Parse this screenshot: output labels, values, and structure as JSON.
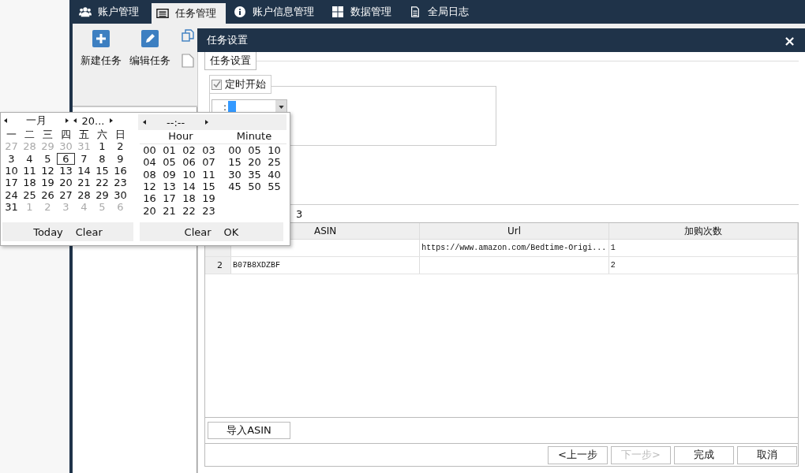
{
  "app_tabs": [
    {
      "label": "账户管理",
      "kind": "users",
      "selected": false
    },
    {
      "label": "任务管理",
      "kind": "list",
      "selected": true
    },
    {
      "label": "账户信息管理",
      "kind": "info",
      "selected": false
    },
    {
      "label": "数据管理",
      "kind": "grid",
      "selected": false
    },
    {
      "label": "全局日志",
      "kind": "doc",
      "selected": false
    }
  ],
  "toolbar": [
    {
      "label": "新建任务",
      "kind": "plus"
    },
    {
      "label": "编辑任务",
      "kind": "edit"
    }
  ],
  "dialog": {
    "title": "任务设置",
    "close": "×",
    "group_title": "任务设置",
    "schedule": {
      "label": "定时开始",
      "checked": true,
      "time_value": ":"
    },
    "count_text": "3",
    "table": {
      "columns": [
        "ASIN",
        "Url",
        "加购次数"
      ],
      "rows": [
        {
          "url": "https://www.amazon.com/Bedtime-Origi...",
          "count": "1"
        },
        {
          "number": "2",
          "asin": "B07B8XDZBF",
          "url": "",
          "count": "2"
        }
      ]
    },
    "import_button": "导入ASIN",
    "nav_buttons": [
      {
        "label": "<上一步",
        "disabled": false
      },
      {
        "label": "下一步>",
        "disabled": true
      },
      {
        "label": "完成",
        "disabled": false
      },
      {
        "label": "取消",
        "disabled": false
      }
    ]
  },
  "date_picker": {
    "month": "一月",
    "year": "20...",
    "weekdays": [
      "一",
      "二",
      "三",
      "四",
      "五",
      "六",
      "日"
    ],
    "days": [
      {
        "day": "27",
        "outside": true,
        "selected": false
      },
      {
        "day": "28",
        "outside": true,
        "selected": false
      },
      {
        "day": "29",
        "outside": true,
        "selected": false
      },
      {
        "day": "30",
        "outside": true,
        "selected": false
      },
      {
        "day": "31",
        "outside": true,
        "selected": false
      },
      {
        "day": "1",
        "outside": false,
        "selected": false
      },
      {
        "day": "2",
        "outside": false,
        "selected": false
      },
      {
        "day": "3",
        "outside": false,
        "selected": false
      },
      {
        "day": "4",
        "outside": false,
        "selected": false
      },
      {
        "day": "5",
        "outside": false,
        "selected": false
      },
      {
        "day": "6",
        "outside": false,
        "selected": true
      },
      {
        "day": "7",
        "outside": false,
        "selected": false
      },
      {
        "day": "8",
        "outside": false,
        "selected": false
      },
      {
        "day": "9",
        "outside": false,
        "selected": false
      },
      {
        "day": "10",
        "outside": false,
        "selected": false
      },
      {
        "day": "11",
        "outside": false,
        "selected": false
      },
      {
        "day": "12",
        "outside": false,
        "selected": false
      },
      {
        "day": "13",
        "outside": false,
        "selected": false
      },
      {
        "day": "14",
        "outside": false,
        "selected": false
      },
      {
        "day": "15",
        "outside": false,
        "selected": false
      },
      {
        "day": "16",
        "outside": false,
        "selected": false
      },
      {
        "day": "17",
        "outside": false,
        "selected": false
      },
      {
        "day": "18",
        "outside": false,
        "selected": false
      },
      {
        "day": "19",
        "outside": false,
        "selected": false
      },
      {
        "day": "20",
        "outside": false,
        "selected": false
      },
      {
        "day": "21",
        "outside": false,
        "selected": false
      },
      {
        "day": "22",
        "outside": false,
        "selected": false
      },
      {
        "day": "23",
        "outside": false,
        "selected": false
      },
      {
        "day": "24",
        "outside": false,
        "selected": false
      },
      {
        "day": "25",
        "outside": false,
        "selected": false
      },
      {
        "day": "26",
        "outside": false,
        "selected": false
      },
      {
        "day": "27",
        "outside": false,
        "selected": false
      },
      {
        "day": "28",
        "outside": false,
        "selected": false
      },
      {
        "day": "29",
        "outside": false,
        "selected": false
      },
      {
        "day": "30",
        "outside": false,
        "selected": false
      },
      {
        "day": "31",
        "outside": false,
        "selected": false
      },
      {
        "day": "1",
        "outside": true,
        "selected": false
      },
      {
        "day": "2",
        "outside": true,
        "selected": false
      },
      {
        "day": "3",
        "outside": true,
        "selected": false
      },
      {
        "day": "4",
        "outside": true,
        "selected": false
      },
      {
        "day": "5",
        "outside": true,
        "selected": false
      },
      {
        "day": "6",
        "outside": true,
        "selected": false
      }
    ],
    "footer": [
      "Today",
      "Clear"
    ]
  },
  "time_picker": {
    "display": "--:--",
    "hour_label": "Hour",
    "minute_label": "Minute",
    "hours": [
      "00",
      "01",
      "02",
      "03",
      "04",
      "05",
      "06",
      "07",
      "08",
      "09",
      "10",
      "11",
      "12",
      "13",
      "14",
      "15",
      "16",
      "17",
      "18",
      "19",
      "20",
      "21",
      "22",
      "23"
    ],
    "minutes": [
      "00",
      "05",
      "10",
      "15",
      "20",
      "25",
      "30",
      "35",
      "40",
      "45",
      "50",
      "55"
    ],
    "footer": [
      "Clear",
      "OK"
    ]
  }
}
